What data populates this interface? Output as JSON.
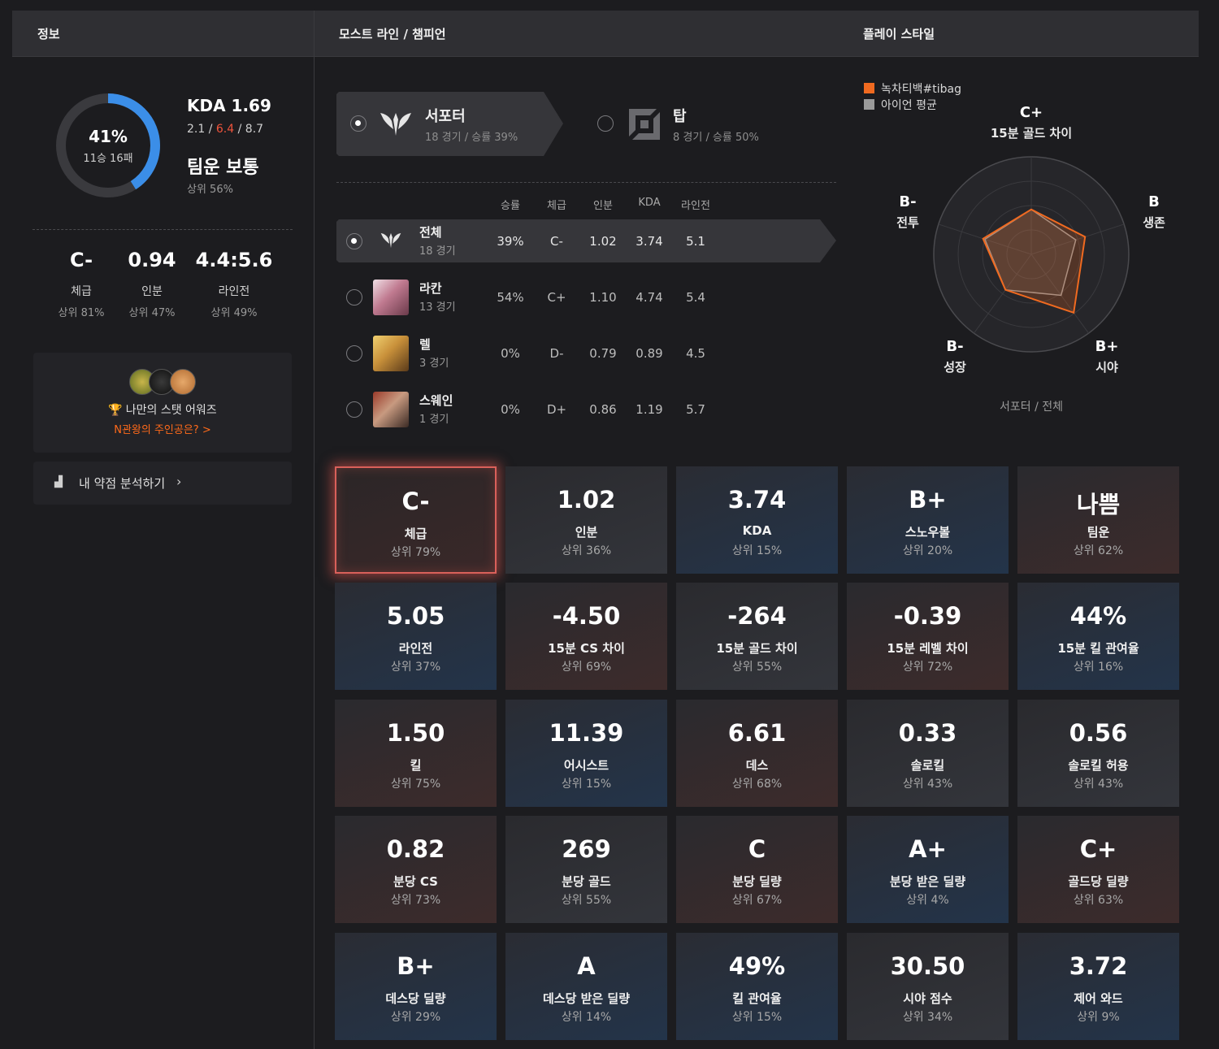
{
  "header": {
    "info": "정보",
    "most": "모스트 라인 / 챔피언",
    "style": "플레이 스타일"
  },
  "profile": {
    "winrate": "41%",
    "record": "11승 16패",
    "winrate_fraction": 0.41,
    "kda_title": "KDA 1.69",
    "kills": "2.1",
    "deaths": "6.4",
    "assists": "8.7",
    "sep": " / ",
    "team_title": "팀운 보통",
    "team_rank": "상위 56%"
  },
  "summary": [
    {
      "value": "C-",
      "label": "체급",
      "rank": "상위 81%"
    },
    {
      "value": "0.94",
      "label": "인분",
      "rank": "상위 47%"
    },
    {
      "value": "4.4:5.6",
      "label": "라인전",
      "rank": "상위 49%"
    }
  ],
  "award": {
    "title": "나만의 스탯 어워즈",
    "link": "N관왕의 주인공은? >"
  },
  "weakness": {
    "label": "내 약점 분석하기"
  },
  "lanes": [
    {
      "name": "서포터",
      "sub": "18 경기 / 승률 39%",
      "selected": true
    },
    {
      "name": "탑",
      "sub": "8 경기 / 승률 50%",
      "selected": false
    }
  ],
  "table": {
    "headers": [
      "승률",
      "체급",
      "인분",
      "KDA",
      "라인전"
    ],
    "rows": [
      {
        "name": "전체",
        "games": "18 경기",
        "cells": [
          "39%",
          "C-",
          "1.02",
          "3.74",
          "5.1"
        ]
      },
      {
        "name": "라칸",
        "games": "13 경기",
        "cells": [
          "54%",
          "C+",
          "1.10",
          "4.74",
          "5.4"
        ]
      },
      {
        "name": "렐",
        "games": "3 경기",
        "cells": [
          "0%",
          "D-",
          "0.79",
          "0.89",
          "4.5"
        ]
      },
      {
        "name": "스웨인",
        "games": "1 경기",
        "cells": [
          "0%",
          "D+",
          "0.86",
          "1.19",
          "5.7"
        ]
      }
    ]
  },
  "radar": {
    "legend_player": "녹차티백#tibag",
    "legend_avg": "아이언 평균",
    "player_color": "#f06a20",
    "avg_color": "#9a9a9a",
    "axes": [
      {
        "grade": "C+",
        "name": "15분 골드 차이",
        "player": 0.46,
        "avg": 0.46
      },
      {
        "grade": "B",
        "name": "생존",
        "player": 0.58,
        "avg": 0.48
      },
      {
        "grade": "B+",
        "name": "시야",
        "player": 0.74,
        "avg": 0.52
      },
      {
        "grade": "B-",
        "name": "성장",
        "player": 0.45,
        "avg": 0.45
      },
      {
        "grade": "B-",
        "name": "전투",
        "player": 0.52,
        "avg": 0.5
      }
    ],
    "footer": "서포터 / 전체"
  },
  "tiles": [
    {
      "value": "C-",
      "label": "체급",
      "rank": "상위 79%",
      "tone": "red",
      "highlight": true
    },
    {
      "value": "1.02",
      "label": "인분",
      "rank": "상위 36%",
      "tone": "gray"
    },
    {
      "value": "3.74",
      "label": "KDA",
      "rank": "상위 15%",
      "tone": "blue"
    },
    {
      "value": "B+",
      "label": "스노우볼",
      "rank": "상위 20%",
      "tone": "blue"
    },
    {
      "value": "나쁨",
      "label": "팀운",
      "rank": "상위 62%",
      "tone": "red"
    },
    {
      "value": "5.05",
      "label": "라인전",
      "rank": "상위 37%",
      "tone": "blue"
    },
    {
      "value": "-4.50",
      "label": "15분 CS 차이",
      "rank": "상위 69%",
      "tone": "red"
    },
    {
      "value": "-264",
      "label": "15분 골드 차이",
      "rank": "상위 55%",
      "tone": "gray"
    },
    {
      "value": "-0.39",
      "label": "15분 레벨 차이",
      "rank": "상위 72%",
      "tone": "red"
    },
    {
      "value": "44%",
      "label": "15분 킬 관여율",
      "rank": "상위 16%",
      "tone": "blue"
    },
    {
      "value": "1.50",
      "label": "킬",
      "rank": "상위 75%",
      "tone": "red"
    },
    {
      "value": "11.39",
      "label": "어시스트",
      "rank": "상위 15%",
      "tone": "blue"
    },
    {
      "value": "6.61",
      "label": "데스",
      "rank": "상위 68%",
      "tone": "red"
    },
    {
      "value": "0.33",
      "label": "솔로킬",
      "rank": "상위 43%",
      "tone": "gray"
    },
    {
      "value": "0.56",
      "label": "솔로킬 허용",
      "rank": "상위 43%",
      "tone": "gray"
    },
    {
      "value": "0.82",
      "label": "분당 CS",
      "rank": "상위 73%",
      "tone": "red"
    },
    {
      "value": "269",
      "label": "분당 골드",
      "rank": "상위 55%",
      "tone": "gray"
    },
    {
      "value": "C",
      "label": "분당 딜량",
      "rank": "상위 67%",
      "tone": "red"
    },
    {
      "value": "A+",
      "label": "분당 받은 딜량",
      "rank": "상위 4%",
      "tone": "blue"
    },
    {
      "value": "C+",
      "label": "골드당 딜량",
      "rank": "상위 63%",
      "tone": "red"
    },
    {
      "value": "B+",
      "label": "데스당 딜량",
      "rank": "상위 29%",
      "tone": "blue"
    },
    {
      "value": "A",
      "label": "데스당 받은 딜량",
      "rank": "상위 14%",
      "tone": "blue"
    },
    {
      "value": "49%",
      "label": "킬 관여율",
      "rank": "상위 15%",
      "tone": "blue"
    },
    {
      "value": "30.50",
      "label": "시야 점수",
      "rank": "상위 34%",
      "tone": "gray"
    },
    {
      "value": "3.72",
      "label": "제어 와드",
      "rank": "상위 9%",
      "tone": "blue"
    }
  ]
}
